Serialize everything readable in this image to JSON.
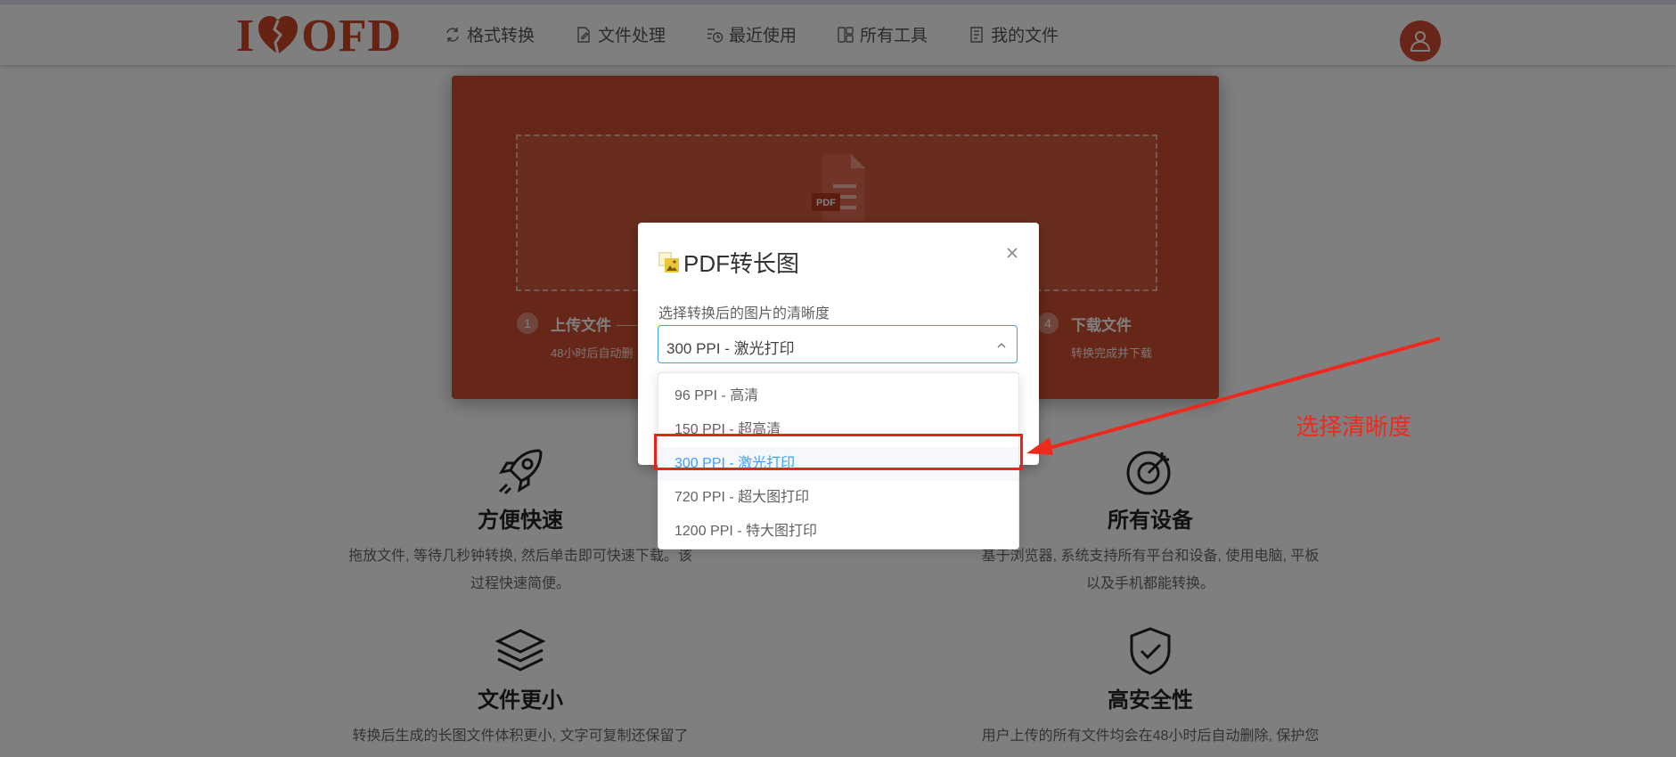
{
  "header": {
    "logo_text_left": "I",
    "logo_text_right": "OFD",
    "nav": [
      {
        "label": "格式转换",
        "icon": "format-convert-icon"
      },
      {
        "label": "文件处理",
        "icon": "file-process-icon"
      },
      {
        "label": "最近使用",
        "icon": "recent-icon"
      },
      {
        "label": "所有工具",
        "icon": "all-tools-icon"
      },
      {
        "label": "我的文件",
        "icon": "my-files-icon"
      }
    ],
    "avatar_icon": "user-icon"
  },
  "panel": {
    "file_badge": "PDF",
    "steps": [
      {
        "num": "1",
        "title": "上传文件",
        "sub": "48小时后自动删"
      },
      {
        "num": "4",
        "title": "下载文件",
        "sub": "转换完成并下载"
      }
    ]
  },
  "features": [
    {
      "icon": "rocket-icon",
      "title": "方便快速",
      "desc": [
        "拖放文件, 等待几秒钟转换, 然后单击即可快速下载。该",
        "过程快速简便。"
      ]
    },
    {
      "icon": "target-icon",
      "title": "所有设备",
      "desc": [
        "基于浏览器, 系统支持所有平台和设备, 使用电脑, 平板",
        "以及手机都能转换。"
      ]
    },
    {
      "icon": "layers-icon",
      "title": "文件更小",
      "desc": [
        "转换后生成的长图文件体积更小, 文字可复制还保留了"
      ]
    },
    {
      "icon": "shield-check-icon",
      "title": "高安全性",
      "desc": [
        "用户上传的所有文件均会在48小时后自动删除, 保护您"
      ]
    }
  ],
  "modal": {
    "title": "PDF转长图",
    "select_label": "选择转换后的图片的清晰度",
    "select_value": "300 PPI - 激光打印",
    "options": [
      "96 PPI - 高清",
      "150 PPI - 超高清",
      "300 PPI - 激光打印",
      "720 PPI - 超大图打印",
      "1200 PPI - 特大图打印"
    ],
    "selected_index": 2
  },
  "annotation": {
    "text": "选择清晰度",
    "color": "#ee2a1f"
  },
  "colors": {
    "brand": "#cf4e31",
    "select_active": "#409eff"
  }
}
